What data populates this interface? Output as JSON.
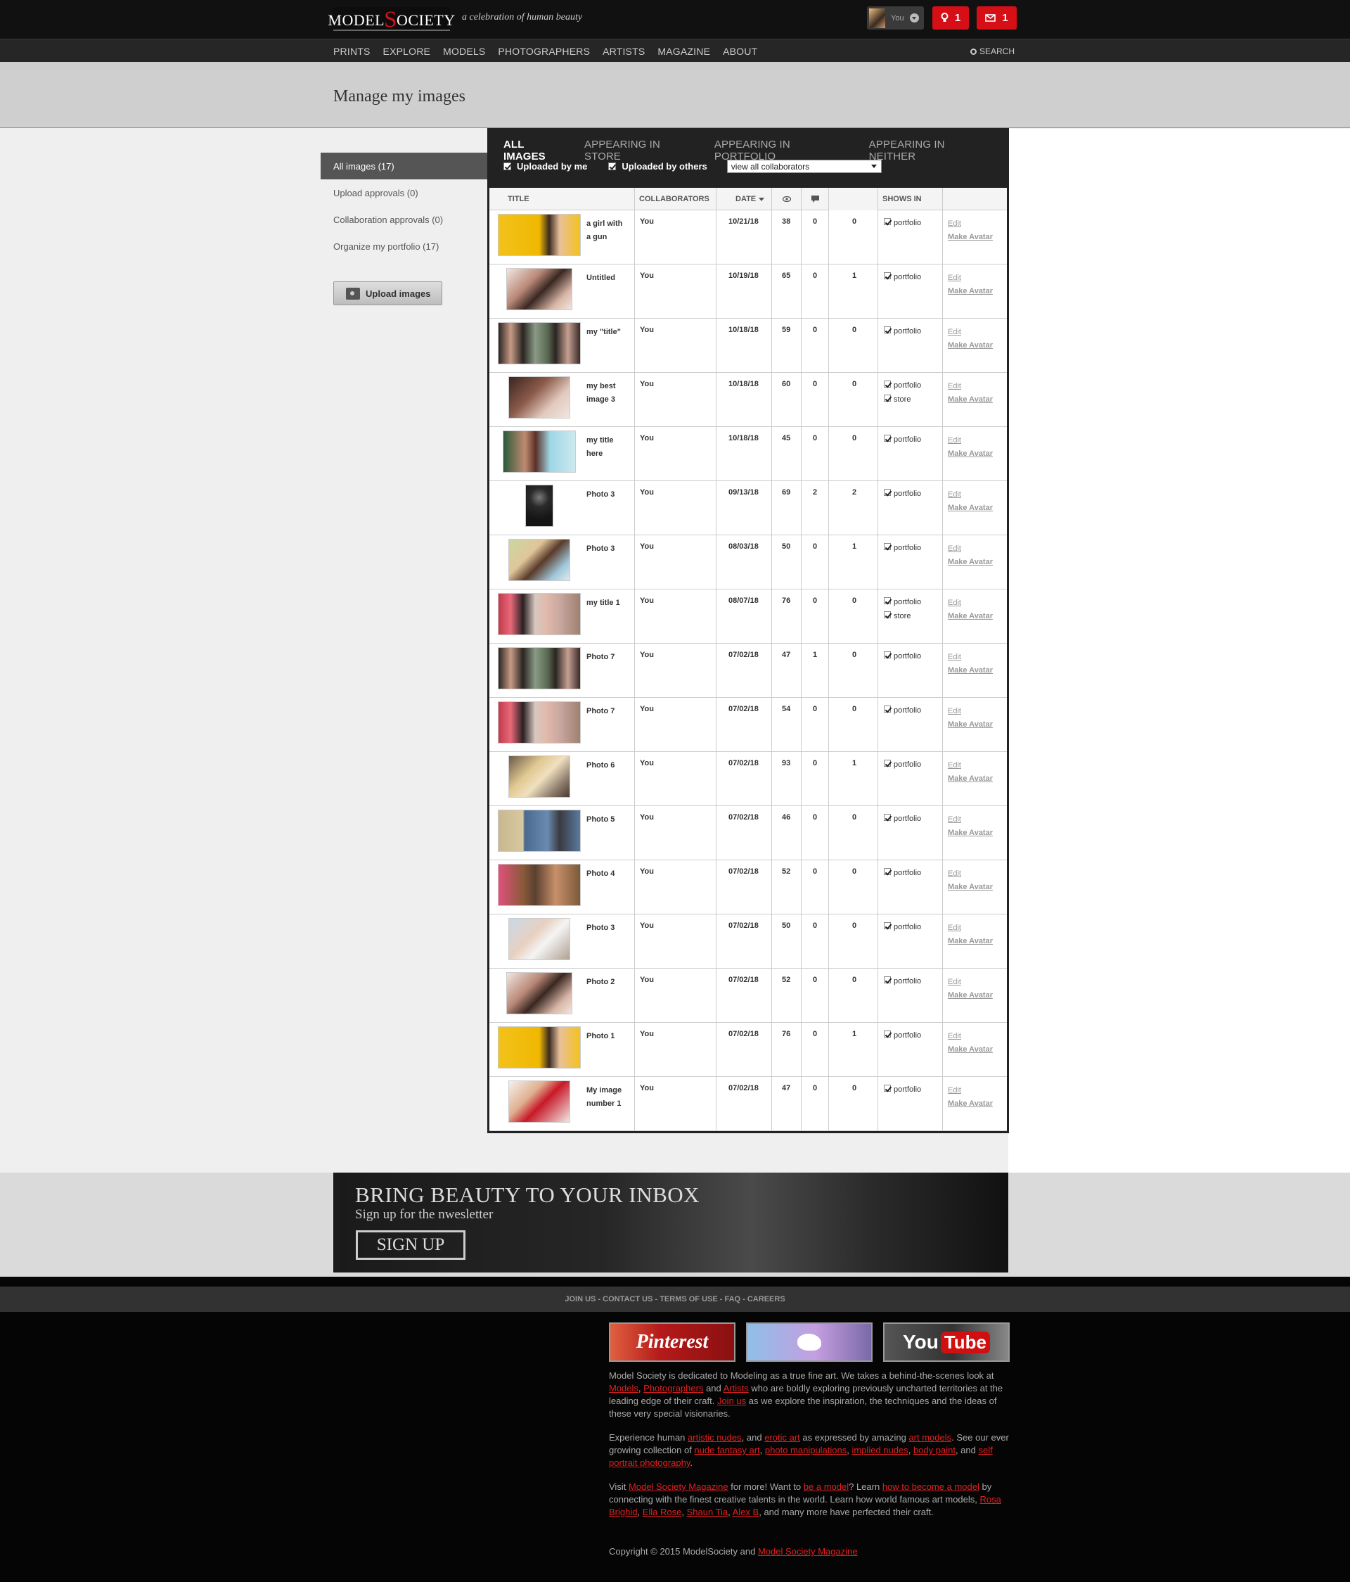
{
  "header": {
    "logo_left": "MODEL",
    "logo_s": "S",
    "logo_right": "OCIETY",
    "tagline": "a celebration of human beauty",
    "user_label": "You",
    "notif_count": "1",
    "msg_count": "1"
  },
  "nav": {
    "items": [
      "PRINTS",
      "EXPLORE",
      "MODELS",
      "PHOTOGRAPHERS",
      "ARTISTS",
      "MAGAZINE",
      "ABOUT"
    ],
    "search": "SEARCH"
  },
  "page_title": "Manage my images",
  "sidebar": {
    "items": [
      {
        "label": "All images (17)",
        "active": true
      },
      {
        "label": "Upload approvals (0)",
        "active": false
      },
      {
        "label": "Collaboration approvals (0)",
        "active": false
      },
      {
        "label": "Organize my portfolio (17)",
        "active": false
      }
    ],
    "upload_button": "Upload images"
  },
  "tabs": [
    "ALL IMAGES",
    "APPEARING IN STORE",
    "APPEARING IN PORTFOLIO",
    "APPEARING IN NEITHER"
  ],
  "filters": {
    "uploaded_by_me": "Uploaded by me",
    "uploaded_by_others": "Uploaded by others",
    "collaborators_select": "view all collaborators"
  },
  "table": {
    "headers": {
      "title": "TITLE",
      "collaborators": "COLLABORATORS",
      "date": "DATE",
      "shows_in": "SHOWS IN"
    },
    "edit_label": "Edit",
    "avatar_label": "Make Avatar",
    "rows": [
      {
        "title": "a girl with a gun",
        "collab": "You",
        "date": "10/21/18",
        "views": "38",
        "comments": "0",
        "third": "0",
        "shows": [
          "portfolio"
        ],
        "thumb": "yellow-wide"
      },
      {
        "title": "Untitled",
        "collab": "You",
        "date": "10/19/18",
        "views": "65",
        "comments": "0",
        "third": "1",
        "shows": [
          "portfolio"
        ],
        "thumb": "face"
      },
      {
        "title": "my \"title\"",
        "collab": "You",
        "date": "10/18/18",
        "views": "59",
        "comments": "0",
        "third": "0",
        "shows": [
          "portfolio"
        ],
        "thumb": "triptych"
      },
      {
        "title": "my best image 3",
        "collab": "You",
        "date": "10/18/18",
        "views": "60",
        "comments": "0",
        "third": "0",
        "shows": [
          "portfolio",
          "store"
        ],
        "thumb": "brown"
      },
      {
        "title": "my title here",
        "collab": "You",
        "date": "10/18/18",
        "views": "45",
        "comments": "0",
        "third": "0",
        "shows": [
          "portfolio"
        ],
        "thumb": "teal"
      },
      {
        "title": "Photo 3",
        "collab": "You",
        "date": "09/13/18",
        "views": "69",
        "comments": "2",
        "third": "2",
        "shows": [
          "portfolio"
        ],
        "thumb": "dark"
      },
      {
        "title": "Photo 3",
        "collab": "You",
        "date": "08/03/18",
        "views": "50",
        "comments": "0",
        "third": "1",
        "shows": [
          "portfolio"
        ],
        "thumb": "green"
      },
      {
        "title": "my title 1",
        "collab": "You",
        "date": "08/07/18",
        "views": "76",
        "comments": "0",
        "third": "0",
        "shows": [
          "portfolio",
          "store"
        ],
        "thumb": "redtrip"
      },
      {
        "title": "Photo 7",
        "collab": "You",
        "date": "07/02/18",
        "views": "47",
        "comments": "1",
        "third": "0",
        "shows": [
          "portfolio"
        ],
        "thumb": "triptych"
      },
      {
        "title": "Photo 7",
        "collab": "You",
        "date": "07/02/18",
        "views": "54",
        "comments": "0",
        "third": "0",
        "shows": [
          "portfolio"
        ],
        "thumb": "redtrip"
      },
      {
        "title": "Photo 6",
        "collab": "You",
        "date": "07/02/18",
        "views": "93",
        "comments": "0",
        "third": "1",
        "shows": [
          "portfolio"
        ],
        "thumb": "blonde"
      },
      {
        "title": "Photo 5",
        "collab": "You",
        "date": "07/02/18",
        "views": "46",
        "comments": "0",
        "third": "0",
        "shows": [
          "portfolio"
        ],
        "thumb": "blue"
      },
      {
        "title": "Photo 4",
        "collab": "You",
        "date": "07/02/18",
        "views": "52",
        "comments": "0",
        "third": "0",
        "shows": [
          "portfolio"
        ],
        "thumb": "pink"
      },
      {
        "title": "Photo 3",
        "collab": "You",
        "date": "07/02/18",
        "views": "50",
        "comments": "0",
        "third": "0",
        "shows": [
          "portfolio"
        ],
        "thumb": "white"
      },
      {
        "title": "Photo 2",
        "collab": "You",
        "date": "07/02/18",
        "views": "52",
        "comments": "0",
        "third": "0",
        "shows": [
          "portfolio"
        ],
        "thumb": "face"
      },
      {
        "title": "Photo 1",
        "collab": "You",
        "date": "07/02/18",
        "views": "76",
        "comments": "0",
        "third": "1",
        "shows": [
          "portfolio"
        ],
        "thumb": "yellow-wide"
      },
      {
        "title": "My image number 1",
        "collab": "You",
        "date": "07/02/18",
        "views": "47",
        "comments": "0",
        "third": "0",
        "shows": [
          "portfolio"
        ],
        "thumb": "redlay"
      }
    ]
  },
  "newsletter": {
    "headline": "BRING BEAUTY TO YOUR INBOX",
    "subline": "Sign up for the nwesletter",
    "button": "SIGN UP"
  },
  "footer": {
    "links": "JOIN US - CONTACT US - TERMS OF USE - FAQ - CAREERS",
    "pinterest": "Pinterest",
    "youtube_you": "You",
    "youtube_tube": "Tube",
    "p1": "Model Society is dedicated to Modeling as a true fine art. We takes a behind-the-scenes look at",
    "p1_links": [
      "Models",
      "Photographers",
      "Artists",
      "Join us"
    ],
    "p1_and": "and",
    "p1_mid": "who are boldly exploring previously uncharted territories at the leading edge of their craft.",
    "p1_end": "as we explore the inspiration, the techniques and the ideas of these very special visionaries.",
    "p2_a": "Experience human",
    "p2_links": [
      "artistic nudes",
      "erotic art",
      "art models",
      "nude fantasy art",
      "photo manipulations",
      "implied nudes",
      "body paint",
      "self portrait photography"
    ],
    "p2_and": "and",
    "p2_b": "as expressed by amazing",
    "p2_c": ". See our ever growing collection of",
    "p2_d": ", and",
    "p3_a": "Visit",
    "p3_links": [
      "Model Society Magazine",
      "be a model",
      "how to become a model",
      "Rosa Brighid",
      "Ella Rose",
      "Shaun Tia",
      "Alex B"
    ],
    "p3_b": "for more! Want to",
    "p3_c": "? Learn",
    "p3_d": "by connecting with the finest creative talents in the world. Learn how world famous art models,",
    "p3_e": ", and many more have perfected their craft.",
    "copyright": "Copyright © 2015 ModelSociety and",
    "copyright_link": "Model Society Magazine"
  }
}
